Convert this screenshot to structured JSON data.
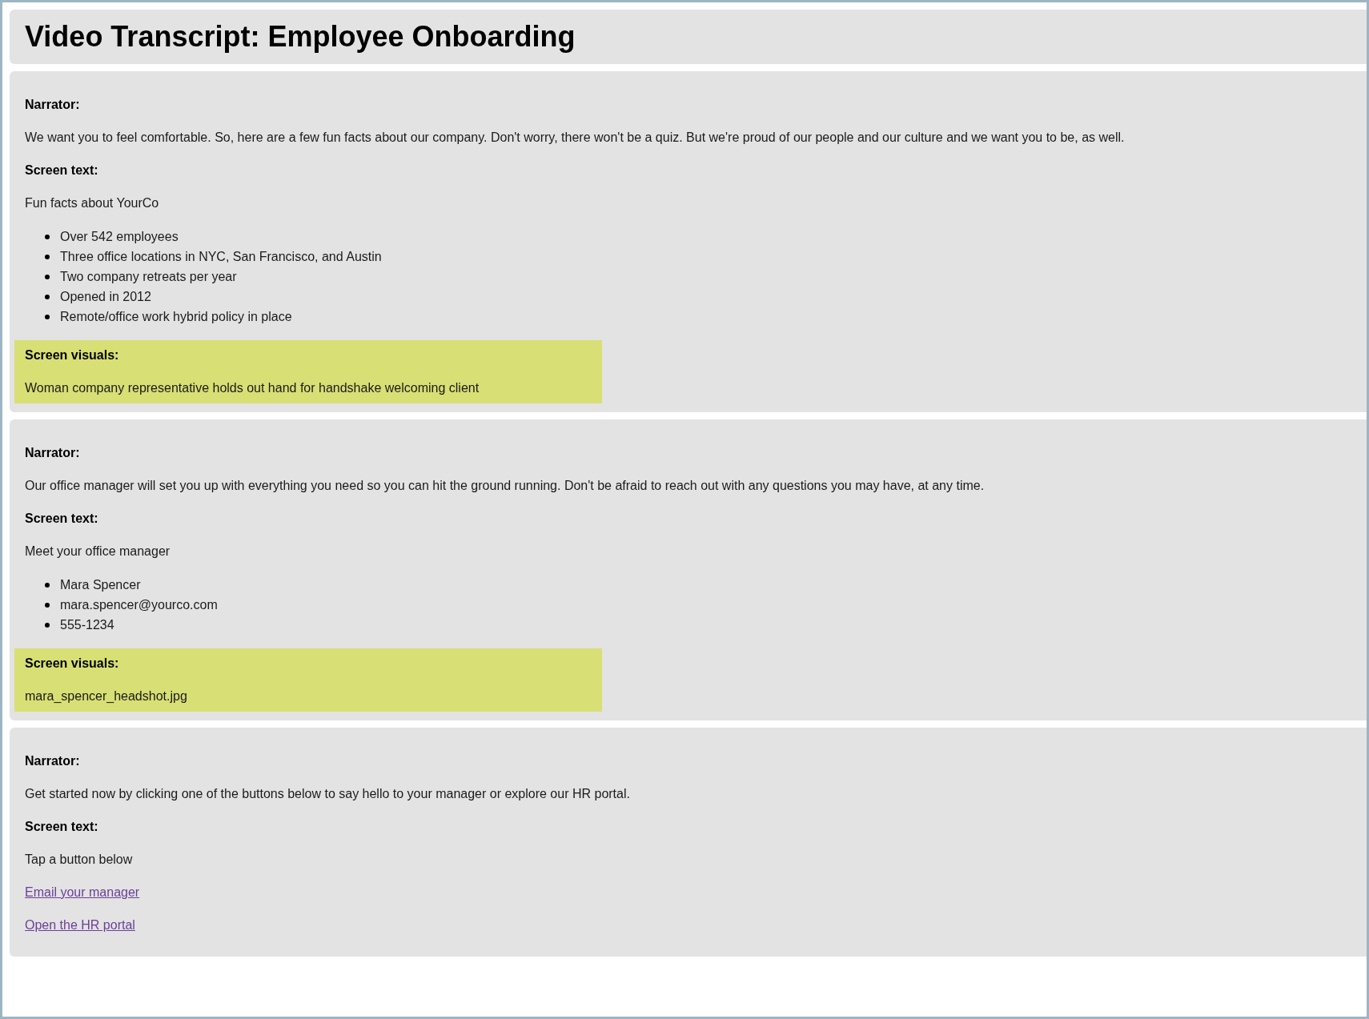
{
  "title": "Video Transcript: Employee Onboarding",
  "sections": [
    {
      "narrator_label": "Narrator:",
      "narrator": "We want you to feel comfortable. So, here are a few fun facts about our company. Don't worry, there won't be a quiz. But we're proud of our people and our culture and we want you to be, as well.",
      "screen_text_label": "Screen text:",
      "screen_text": "Fun facts about YourCo",
      "bullets": [
        "Over 542 employees",
        "Three office locations in NYC, San Francisco, and Austin",
        "Two company retreats per year",
        "Opened in 2012",
        "Remote/office work hybrid policy in place"
      ],
      "visuals_label": "Screen visuals:",
      "visuals": "Woman company representative holds out hand for handshake welcoming client"
    },
    {
      "narrator_label": "Narrator:",
      "narrator": "Our office manager will set you up with everything you need so you can hit the ground running. Don't be afraid to reach out with any questions you may have, at any time.",
      "screen_text_label": "Screen text:",
      "screen_text": "Meet your office manager",
      "bullets": [
        "Mara Spencer",
        "mara.spencer@yourco.com",
        "555-1234"
      ],
      "visuals_label": "Screen visuals:",
      "visuals": "mara_spencer_headshot.jpg"
    },
    {
      "narrator_label": "Narrator:",
      "narrator": "Get started now by clicking one of the buttons below to say hello to your manager or explore our HR portal.",
      "screen_text_label": "Screen text:",
      "screen_text": "Tap a button below",
      "links": [
        "Email your manager",
        "Open the HR portal"
      ]
    }
  ]
}
